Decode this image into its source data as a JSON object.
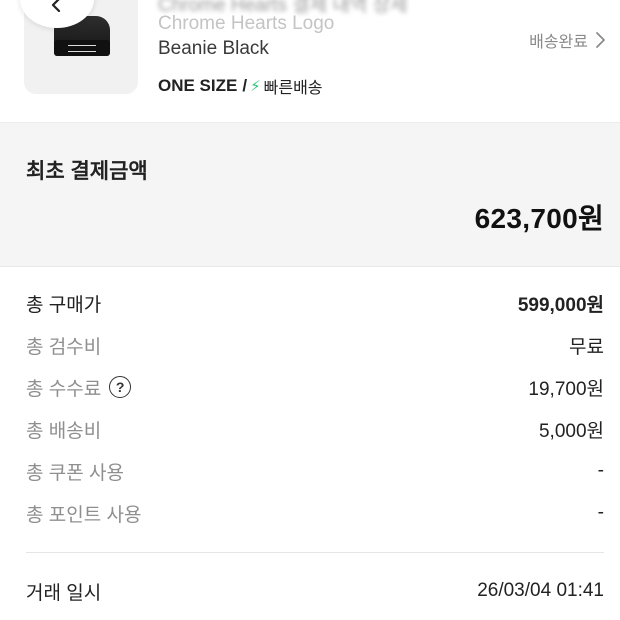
{
  "product": {
    "hidden_title": "Chrome Hearts 결제 내역 상세",
    "name_line1": "Chrome Hearts Logo",
    "name_line2": "Beanie Black",
    "size": "ONE SIZE",
    "slash": "/",
    "bolt_icon": "lightning-icon",
    "fast_delivery": "빠른배송",
    "status": "배송완료",
    "accent_color": "#32c77f"
  },
  "initial_payment": {
    "label": "최초 결제금액",
    "amount": "623,700원"
  },
  "details": [
    {
      "label": "총 구매가",
      "value": "599,000원"
    },
    {
      "label": "총 검수비",
      "value": "무료"
    },
    {
      "label": "총 수수료",
      "value": "19,700원",
      "help_icon": "?"
    },
    {
      "label": "총 배송비",
      "value": "5,000원"
    },
    {
      "label": "총 쿠폰 사용",
      "value": "-"
    },
    {
      "label": "총 포인트 사용",
      "value": "-"
    }
  ],
  "trade_time": {
    "label": "거래 일시",
    "value": "26/03/04 01:41"
  }
}
